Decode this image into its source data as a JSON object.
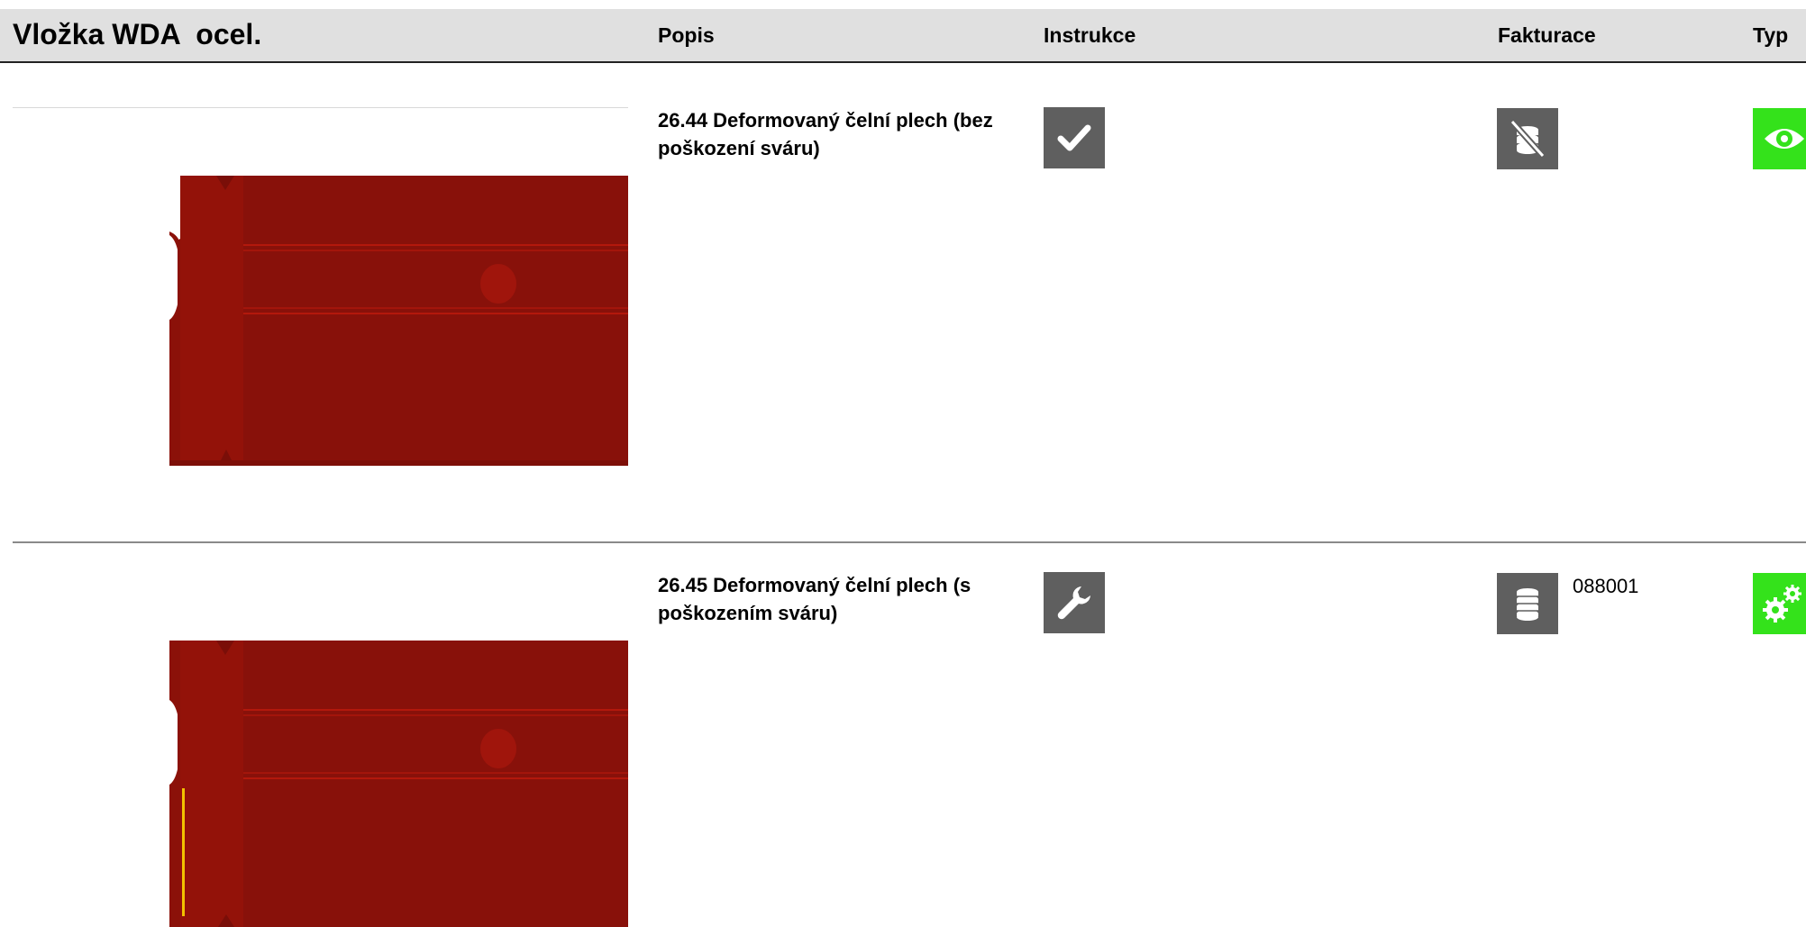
{
  "header": {
    "title": "Vložka WDA  ocel.",
    "columns": {
      "popis": "Popis",
      "instrukce": "Instrukce",
      "fakturace": "Fakturace",
      "typ": "Typ"
    }
  },
  "rows": [
    {
      "description": "26.44 Deformovaný čelní plech (bez poškození sváru)",
      "instruction_icon": "checkmark-icon",
      "billing_icon": "no-coins-icon",
      "billing_code": "",
      "type_icon": "eye-icon",
      "weld_damage_marked": false
    },
    {
      "description": "26.45 Deformovaný čelní plech (s poškozením sváru)",
      "instruction_icon": "wrench-icon",
      "billing_icon": "coins-icon",
      "billing_code": "088001",
      "type_icon": "gears-icon",
      "weld_damage_marked": true
    }
  ],
  "colors": {
    "header_bg": "#e0e0e0",
    "icon_gray": "#5f5f5f",
    "icon_green": "#34e21b",
    "part_red": "#8b1109",
    "weld_mark": "#f2c200"
  }
}
